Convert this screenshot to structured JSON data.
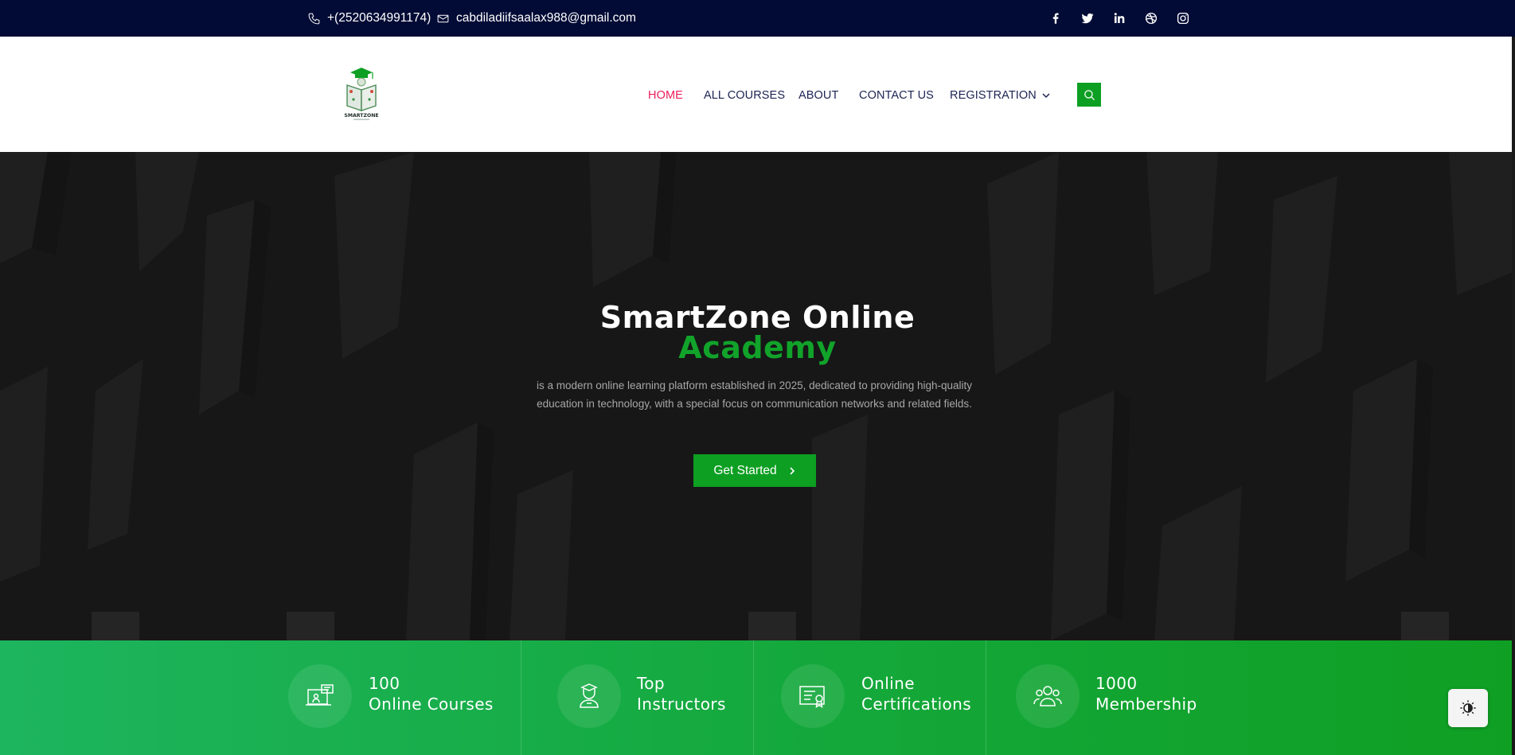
{
  "topbar": {
    "phone": "+(2520634991174)",
    "email": "cabdiladiifsaalax988@gmail.com",
    "phone_icon": "phone-icon",
    "email_icon": "envelope-icon",
    "social": [
      "facebook-icon",
      "twitter-icon",
      "linkedin-icon",
      "dribbble-icon",
      "instagram-icon"
    ]
  },
  "header": {
    "logo_text": "SMARTZONE",
    "nav": {
      "home": "HOME",
      "all_courses": "ALL COURSES",
      "about": "ABOUT",
      "contact_us": "CONTACT US",
      "registration": "REGISTRATION"
    },
    "search_icon": "search-icon"
  },
  "hero": {
    "title_line1": "SmartZone Online",
    "title_line2": "Academy",
    "description": "is a modern online learning platform established in 2025, dedicated to providing high-quality education in technology, with a special focus on communication networks and related fields.",
    "cta_label": "Get Started"
  },
  "features": [
    {
      "line1": "100",
      "line2": "Online Courses",
      "icon": "course-laptop-icon"
    },
    {
      "line1": "Top",
      "line2": "Instructors",
      "icon": "instructor-icon"
    },
    {
      "line1": "Online",
      "line2": "Certifications",
      "icon": "certificate-icon"
    },
    {
      "line1": "1000",
      "line2": "Membership",
      "icon": "members-group-icon"
    }
  ],
  "colors": {
    "topbar": "#020b35",
    "accent_green": "#0d9f22",
    "nav_active": "#ec1c5c",
    "nav_text": "#1c2354",
    "hero_bg": "#171717"
  },
  "theme_toggle_icon": "contrast-icon"
}
